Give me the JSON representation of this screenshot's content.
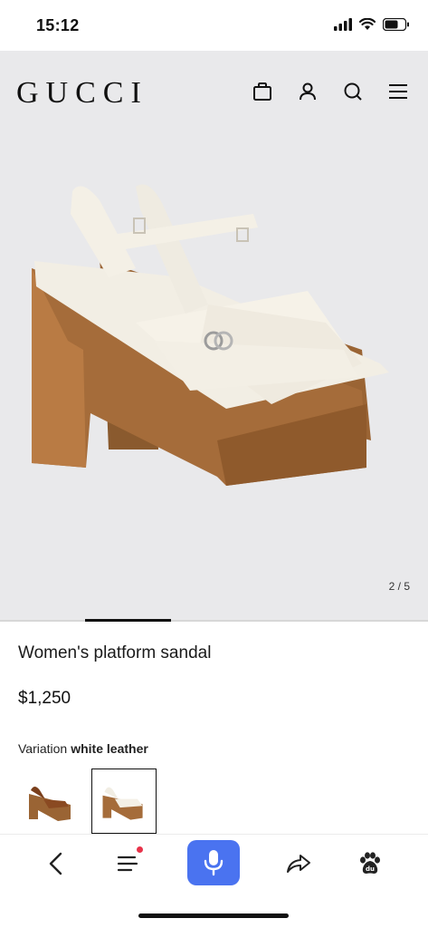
{
  "status_bar": {
    "time": "15:12"
  },
  "header": {
    "brand": "GUCCI"
  },
  "gallery": {
    "page_indicator": "2 / 5"
  },
  "product": {
    "title": "Women's platform sandal",
    "price": "$1,250",
    "variation_label": "Variation",
    "variation_value": "white leather"
  },
  "icons": {
    "header": [
      "shopping-bag-icon",
      "user-icon",
      "search-icon",
      "menu-icon"
    ],
    "bottom_nav": [
      "back-icon",
      "tabs-menu-icon",
      "microphone-icon",
      "share-icon",
      "baidu-paw-icon"
    ]
  },
  "colors": {
    "hero_bg": "#e9e9eb",
    "mic_button": "#4a73f0",
    "badge": "#e8334a"
  }
}
